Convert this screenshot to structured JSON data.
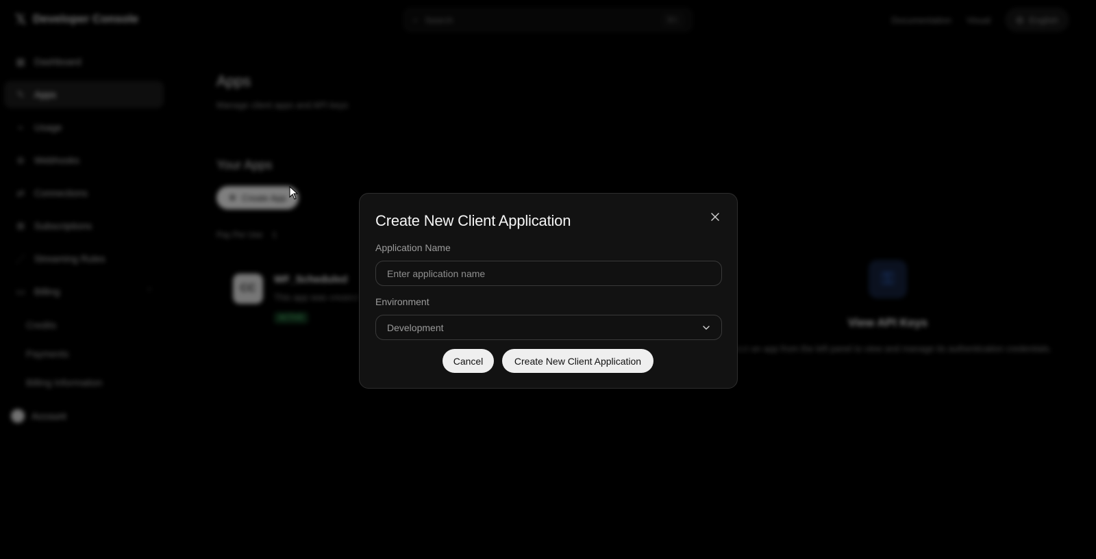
{
  "topbar": {
    "brand": "Developer Console",
    "search_placeholder": "Search",
    "search_shortcut": "⌘K",
    "links": [
      "Documentation",
      "Visual"
    ],
    "account_label": "English"
  },
  "sidebar": {
    "items": [
      {
        "label": "Dashboard",
        "icon": "grid-icon"
      },
      {
        "label": "Apps",
        "icon": "wrench-icon",
        "active": true
      },
      {
        "label": "Usage",
        "icon": "chart-icon"
      },
      {
        "label": "Webhooks",
        "icon": "webhook-icon"
      },
      {
        "label": "Connections",
        "icon": "link-icon"
      },
      {
        "label": "Subscriptions",
        "icon": "subscriptions-icon"
      },
      {
        "label": "Streaming Rules",
        "icon": "stream-icon"
      },
      {
        "label": "Billing",
        "icon": "billing-icon"
      }
    ],
    "billing_sub": [
      "Credits",
      "Payments",
      "Billing Information"
    ],
    "account": "Account"
  },
  "main": {
    "title": "Apps",
    "subtitle": "Manage client apps and API keys",
    "section": "Your Apps",
    "create_button": "Create App",
    "tier": "Pay Per Use",
    "tier_count": "1",
    "app": {
      "logo": "CC",
      "name": "WF_Scheduled",
      "desc": "This app was created",
      "badge": "ACTIVE"
    },
    "keys": {
      "title": "View API Keys",
      "desc": "Select an app from the left panel to view and manage its authentication credentials."
    }
  },
  "modal": {
    "title": "Create New Client Application",
    "name_label": "Application Name",
    "name_placeholder": "Enter application name",
    "name_value": "",
    "env_label": "Environment",
    "env_value": "Development",
    "cancel_label": "Cancel",
    "submit_label": "Create New Client Application"
  }
}
